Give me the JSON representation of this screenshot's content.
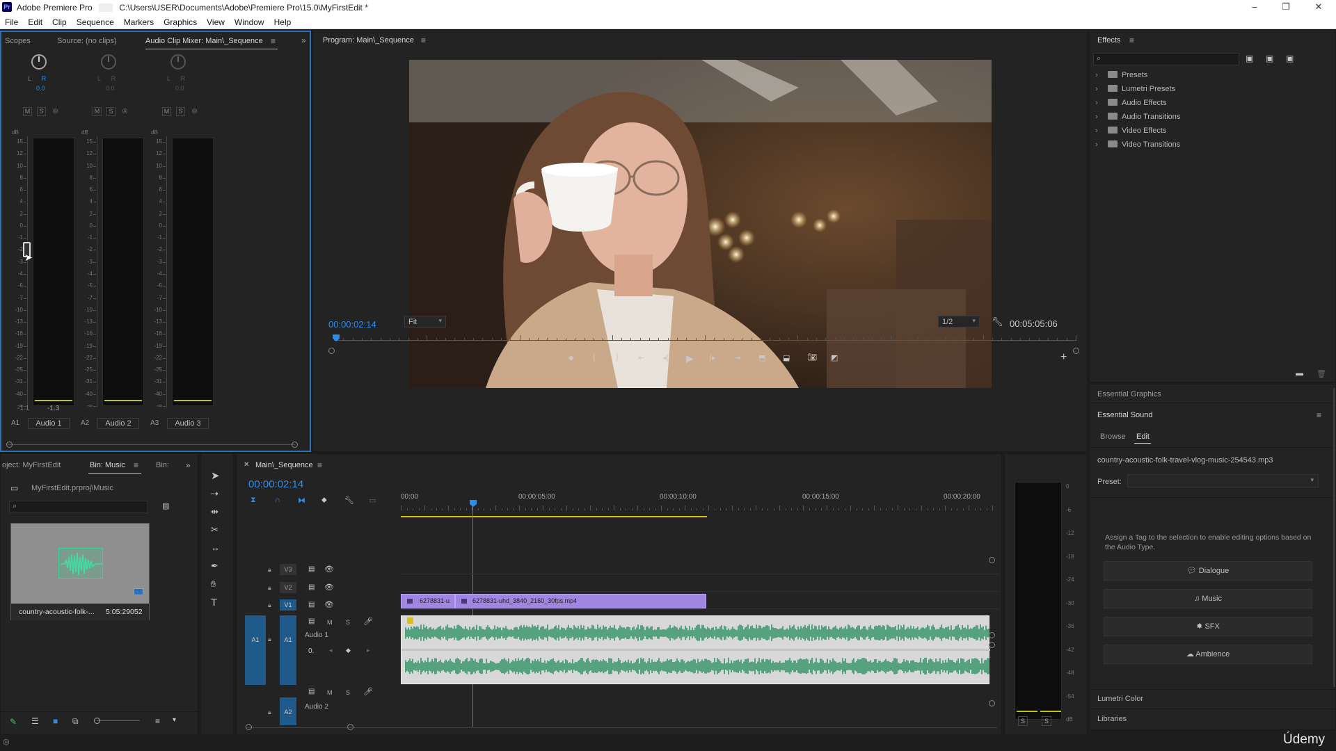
{
  "app": {
    "logo_text": "Pr",
    "title": "Adobe Premiere Pro",
    "file_path": "C:\\Users\\USER\\Documents\\Adobe\\Premiere Pro\\15.0\\MyFirstEdit *",
    "window_controls": [
      "–",
      "❐",
      "✕"
    ]
  },
  "menu": [
    "File",
    "Edit",
    "Clip",
    "Sequence",
    "Markers",
    "Graphics",
    "View",
    "Window",
    "Help"
  ],
  "top_left_panel": {
    "tabs": [
      "Scopes",
      "Source: (no clips)",
      "Audio Clip Mixer: Main\\_Sequence"
    ],
    "overflow": "»",
    "channels": [
      {
        "lr": "L      R",
        "pan": "0.0",
        "mute": "M",
        "solo": "S",
        "record": "◎",
        "peak": "-1.1",
        "vol": "-1.3",
        "track": "A1",
        "name": "Audio 1"
      },
      {
        "lr": "L      R",
        "pan": "0.0",
        "mute": "M",
        "solo": "S",
        "record": "◎",
        "peak": "",
        "vol": "",
        "track": "A2",
        "name": "Audio 2"
      },
      {
        "lr": "L      R",
        "pan": "0.0",
        "mute": "M",
        "solo": "S",
        "record": "◎",
        "peak": "",
        "vol": "",
        "track": "A3",
        "name": "Audio 3"
      }
    ],
    "db_header": "dB",
    "db_scale": [
      "15",
      "12",
      "10",
      "8",
      "6",
      "4",
      "2",
      "0",
      "-1",
      "-2",
      "-3",
      "-4",
      "-5",
      "-7",
      "-10",
      "-13",
      "-16",
      "-19",
      "-22",
      "-25",
      "-31",
      "-40",
      "-∞"
    ],
    "db_scale_left": [
      "15",
      "12",
      "10",
      "8",
      "6",
      "4",
      "2",
      "0",
      "-1",
      "-3",
      "-5",
      "-7",
      "-10",
      "-13",
      "-16",
      "-19",
      "-22",
      "-25",
      "-31",
      "-40",
      "-∞"
    ]
  },
  "program": {
    "tab": "Program: Main\\_Sequence",
    "timecode": "00:00:02:14",
    "fit": "Fit",
    "resolution": "1/2",
    "duration": "00:05:05:06",
    "playhead_fraction": 0.003
  },
  "effects": {
    "tab": "Effects",
    "search_placeholder": "",
    "items": [
      "Presets",
      "Lumetri Presets",
      "Audio Effects",
      "Audio Transitions",
      "Video Effects",
      "Video Transitions"
    ]
  },
  "essential": {
    "graphics_tab": "Essential Graphics",
    "sound_tab": "Essential Sound",
    "subtabs": [
      "Browse",
      "Edit"
    ],
    "clip_name": "country-acoustic-folk-travel-vlog-music-254543.mp3",
    "preset_label": "Preset:",
    "preset_value": "",
    "hint": "Assign a Tag to the selection to enable editing options based on the Audio Type.",
    "buttons": [
      "Dialogue",
      "Music",
      "SFX",
      "Ambience"
    ],
    "lumetri_color": "Lumetri Color",
    "libraries": "Libraries"
  },
  "project": {
    "tabs": [
      "oject: MyFirstEdit",
      "Bin: Music",
      "Bin:"
    ],
    "overflow": "»",
    "path": "MyFirstEdit.prproj\\Music",
    "search_placeholder": "",
    "thumb_name": "country-acoustic-folk-...",
    "thumb_duration": "5:05:29052"
  },
  "timeline": {
    "tab": "Main\\_Sequence",
    "timecode": "00:00:02:14",
    "ruler": [
      "00:00",
      "00:00:05:00",
      "00:00:10:00",
      "00:00:15:00",
      "00:00:20:00"
    ],
    "tracks": {
      "v3": "V3",
      "v2": "V2",
      "v1": "V1",
      "a1_src": "A1",
      "a1": "A1",
      "a1_name": "Audio 1",
      "a2": "A2",
      "a2_name": "Audio 2",
      "m": "M",
      "s": "S"
    },
    "clips": {
      "clip1": "6278831-u",
      "clip2": "6278831-uhd_3840_2160_30fps.mp4"
    },
    "vol_readout": "0."
  },
  "audio_meter": {
    "scale": [
      "0",
      "-6",
      "-12",
      "-18",
      "-24",
      "-30",
      "-36",
      "-42",
      "-48",
      "-54",
      "dB"
    ],
    "solo_left": "S",
    "solo_right": "S"
  },
  "watermark": "Údemy"
}
